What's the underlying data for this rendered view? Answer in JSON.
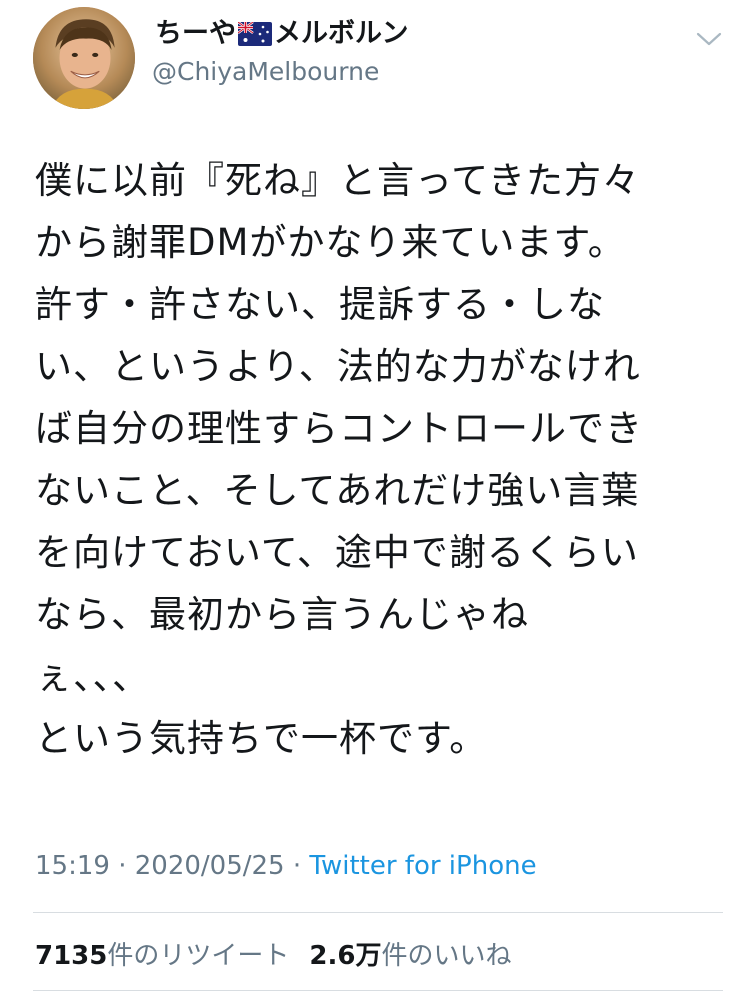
{
  "user": {
    "name_prefix": "ちーや",
    "name_suffix": "メルボルン",
    "flag_icon": "australia-flag-icon",
    "handle": "@ChiyaMelbourne"
  },
  "tweet": {
    "lines": [
      "僕に以前『死ね』と言ってきた方々",
      "から謝罪DMがかなり来ています。",
      "許す・許さない、提訴する・しな",
      "い、というより、法的な力がなけれ",
      "ば自分の理性すらコントロールでき",
      "ないこと、そしてあれだけ強い言葉",
      "を向けておいて、途中で謝るくらい",
      "なら、最初から言うんじゃね",
      "ぇ、、、",
      "という気持ちで一杯です。"
    ]
  },
  "meta": {
    "time": "15:19",
    "separator": "·",
    "date": "2020/05/25",
    "source": "Twitter for iPhone"
  },
  "stats": {
    "retweets_count": "7135",
    "retweets_label": "件のリツイート",
    "likes_count": "2.6万",
    "likes_label": "件のいいね"
  },
  "colors": {
    "text": "#14171a",
    "secondary": "#657786",
    "link": "#1b95e0",
    "divider": "#d8dde1"
  }
}
